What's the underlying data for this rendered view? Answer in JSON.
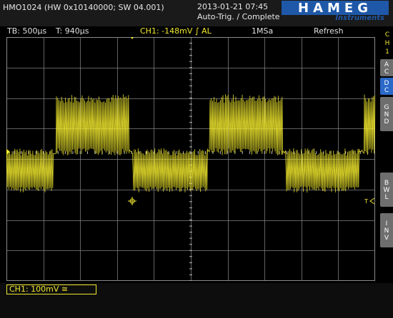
{
  "header": {
    "model": "HMO1024 (HW 0x10140000; SW 04.001)",
    "datetime": "2013-01-21 07:45",
    "status": "Auto-Trig. / Complete",
    "brand": "HAMEG",
    "brand_sub": "Instruments"
  },
  "info": {
    "timebase": "TB: 500µs",
    "trigger_time": "T: 940µs",
    "channel_trigger": "CH1: -148mV ∫ AL",
    "sample_rate": "1MSa",
    "mode": "Refresh"
  },
  "sidebar": {
    "channel": [
      "C",
      "H",
      "1"
    ],
    "ac": [
      "A",
      "C"
    ],
    "dc": [
      "D",
      "C"
    ],
    "gnd": [
      "G",
      "N",
      "D"
    ],
    "bwl": [
      "B",
      "W",
      "L"
    ],
    "inv": [
      "I",
      "N",
      "V"
    ]
  },
  "footer": {
    "scale": "CH1: 100mV ≅"
  },
  "colors": {
    "trace": "#f3ea2e",
    "grid": "#8a8a8a",
    "active_button": "#2b69c8",
    "button": "#6e6e6e",
    "brand": "#1f58a8"
  },
  "markers": {
    "trigger_arrow": "T"
  }
}
